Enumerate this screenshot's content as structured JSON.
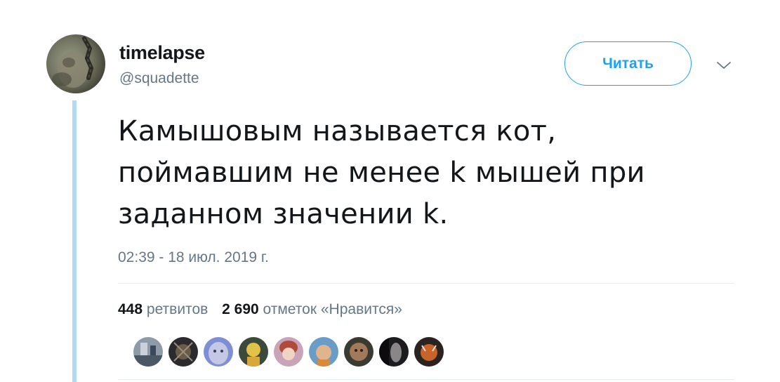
{
  "tweet": {
    "author": {
      "display_name": "timelapse",
      "handle": "@squadette",
      "avatar_icon": "user-avatar"
    },
    "follow_label": "Читать",
    "more_icon": "chevron-down-icon",
    "text_lines": [
      "Камышовым называется кот,",
      "поймавшим не менее k мышей при",
      "заданном значении k."
    ],
    "timestamp": "02:39 - 18 июл. 2019 г.",
    "stats": {
      "retweets_count": "448",
      "retweets_label": "ретвитов",
      "likes_count": "2 690",
      "likes_label": "отметок «Нравится»"
    },
    "likers_count": 9
  },
  "colors": {
    "accent": "#1da1f2",
    "thread_line": "#b3dcf2",
    "text_primary": "#14171a",
    "text_secondary": "#657786",
    "divider": "#e6ecf0"
  }
}
